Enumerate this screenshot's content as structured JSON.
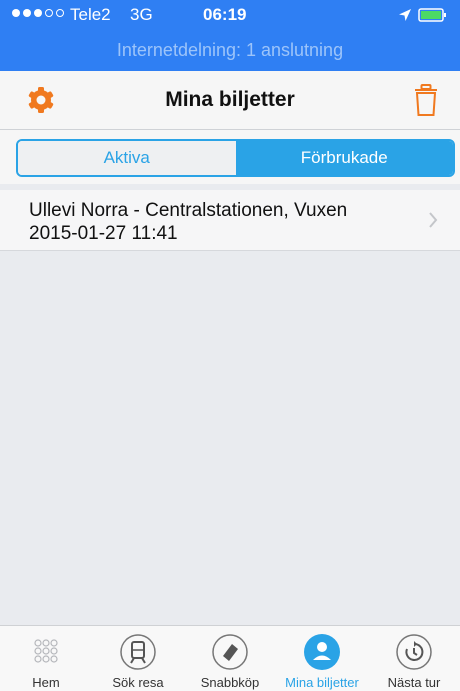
{
  "status_bar": {
    "carrier": "Tele2",
    "network": "3G",
    "time": "06:19",
    "signal_bars": 3,
    "signal_total": 5
  },
  "hotspot_banner": "Internetdelning: 1 anslutning",
  "nav": {
    "title": "Mina biljetter",
    "left_icon": "settings-gear-icon",
    "right_icon": "trash-icon"
  },
  "segments": {
    "active_label": "Aktiva",
    "used_label": "Förbrukade",
    "selected": "Förbrukade"
  },
  "tickets": [
    {
      "title": "Ullevi Norra - Centralstationen, Vuxen",
      "datetime": "2015-01-27 11:41"
    }
  ],
  "tabbar": {
    "items": [
      {
        "label": "Hem",
        "icon": "grid-dots-icon"
      },
      {
        "label": "Sök resa",
        "icon": "tram-icon"
      },
      {
        "label": "Snabbköp",
        "icon": "ticket-icon"
      },
      {
        "label": "Mina biljetter",
        "icon": "user-icon"
      },
      {
        "label": "Nästa tur",
        "icon": "clock-refresh-icon"
      }
    ],
    "selected": "Mina biljetter"
  },
  "colors": {
    "status_blue": "#2f7ff3",
    "accent_blue": "#2aa3e6",
    "settings_orange": "#f0791f",
    "trash_orange": "#f0791f",
    "battery_green": "#4cd964"
  }
}
